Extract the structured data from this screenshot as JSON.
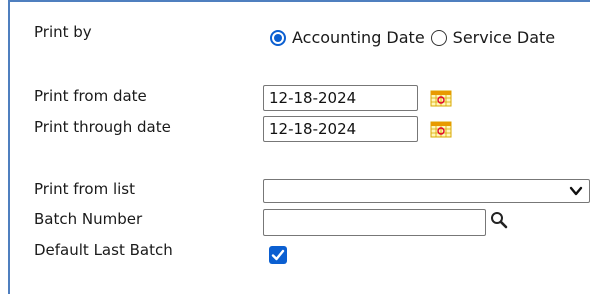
{
  "print_by": {
    "label": "Print by",
    "options": [
      {
        "label": "Accounting Date",
        "selected": true
      },
      {
        "label": "Service Date",
        "selected": false
      }
    ]
  },
  "dates": {
    "from_label": "Print from date",
    "from_value": "12-18-2024",
    "through_label": "Print through date",
    "through_value": "12-18-2024",
    "calendar_icon": "calendar-icon"
  },
  "print_from_list": {
    "label": "Print from list",
    "selected": ""
  },
  "batch": {
    "label": "Batch Number",
    "value": "",
    "search_icon": "search-icon"
  },
  "default_last_batch": {
    "label": "Default Last Batch",
    "checked": true
  },
  "colors": {
    "accent": "#0b5fd1",
    "panel_border": "#4f7fbf"
  }
}
